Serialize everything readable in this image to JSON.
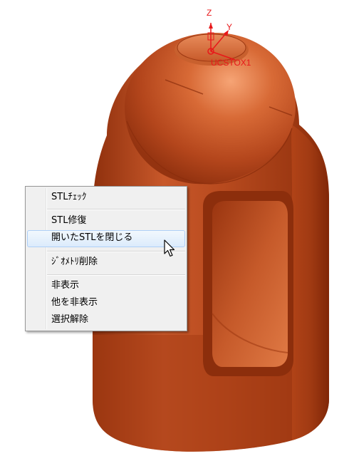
{
  "viewport": {
    "ucs": {
      "axis_z": "Z",
      "axis_y": "Y",
      "name": "UCSTOX1"
    },
    "colors": {
      "model": "#b84a1e",
      "model_dark": "#8e2f0c",
      "model_light": "#f09a6c",
      "ucs": "#e8181a"
    }
  },
  "context_menu": {
    "items": [
      {
        "label": "STLﾁｪｯｸ"
      },
      {
        "label": "STL修復"
      },
      {
        "label": "開いたSTLを閉じる"
      },
      {
        "label": "ｼﾞｵﾒﾄﾘ削除"
      },
      {
        "label": "非表示"
      },
      {
        "label": "他を非表示"
      },
      {
        "label": "選択解除"
      }
    ],
    "hovered_item": "開いたSTLを閉じる"
  },
  "cursor": {
    "icon": "arrow-cursor-icon"
  }
}
